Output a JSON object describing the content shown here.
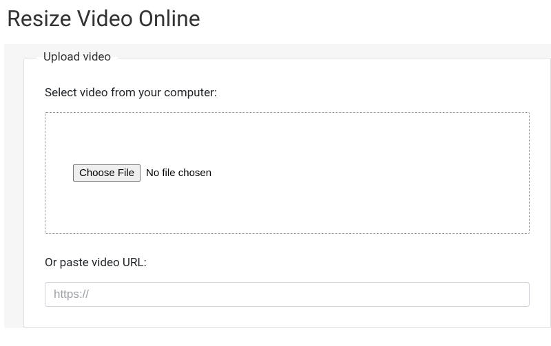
{
  "title": "Resize Video Online",
  "upload": {
    "legend": "Upload video",
    "select_label": "Select video from your computer:",
    "choose_button": "Choose File",
    "file_status": "No file chosen",
    "url_label": "Or paste video URL:",
    "url_placeholder": "https://"
  }
}
